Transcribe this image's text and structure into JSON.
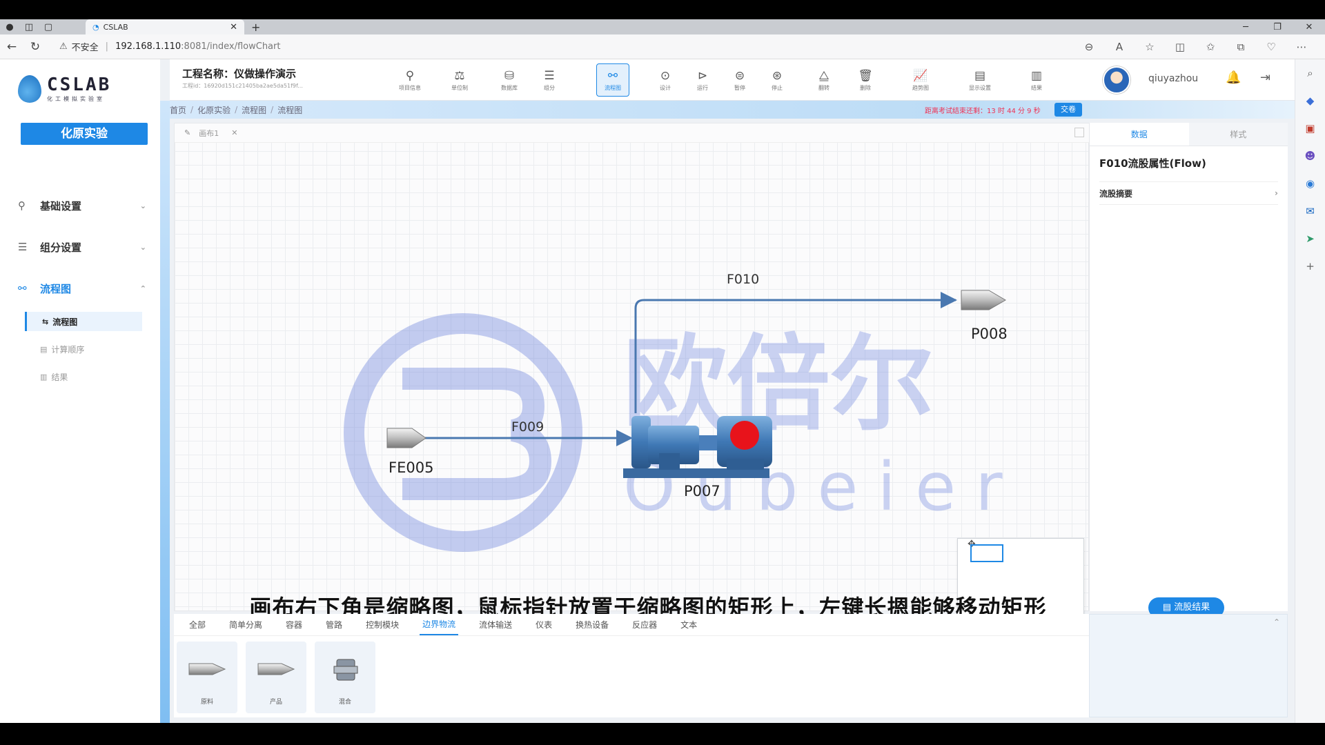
{
  "browser": {
    "tab_title": "CSLAB",
    "security_label": "不安全",
    "url_host": "192.168.1.110",
    "url_path": ":8081/index/flowChart"
  },
  "sidebar": {
    "brand": "CSLAB",
    "brand_sub": "化工模拟实验室",
    "primary_button": "化原实验",
    "groups": [
      {
        "label": "基础设置",
        "icon": "user-tree-icon"
      },
      {
        "label": "组分设置",
        "icon": "components-icon"
      },
      {
        "label": "流程图",
        "icon": "flowchart-icon"
      }
    ],
    "subitems": [
      {
        "label": "流程图",
        "active": true
      },
      {
        "label": "计算顺序",
        "active": false
      },
      {
        "label": "结果",
        "active": false
      }
    ]
  },
  "header": {
    "project_title": "工程名称：仪做操作演示",
    "project_sub": "工程id：16920d151c21405ba2ae5da51f9f...",
    "tools": [
      "项目信息",
      "单位制",
      "数据库",
      "组分",
      "流程图",
      "设计",
      "运行",
      "暂停",
      "停止",
      "翻转",
      "删除",
      "趋势图",
      "显示设置",
      "结果"
    ],
    "active_tool": "流程图",
    "username": "qiuyazhou"
  },
  "breadcrumb": {
    "items": [
      "首页",
      "化原实验",
      "流程图",
      "流程图"
    ],
    "countdown": "距离考试结束还剩：13 时 44 分 9 秒",
    "submit": "交卷"
  },
  "canvas": {
    "tab_name": "画布1",
    "streams": {
      "f010": "F010",
      "f009": "F009"
    },
    "nodes": {
      "fe005": "FE005",
      "p007": "P007",
      "p008": "P008"
    },
    "watermark_cn": "欧倍尔",
    "watermark_en": "Oubeier"
  },
  "caption": "画布右下角是缩略图，鼠标指针放置于缩略图的矩形上，左键长摁能够移动矩形",
  "palette": {
    "tabs": [
      "全部",
      "简单分离",
      "容器",
      "管路",
      "控制模块",
      "边界物流",
      "流体输送",
      "仪表",
      "换热设备",
      "反应器",
      "文本"
    ],
    "active_tab": "边界物流",
    "items": [
      "原料",
      "产品",
      "混合"
    ]
  },
  "properties": {
    "tabs": [
      "数据",
      "样式"
    ],
    "title": "F010流股属性(Flow)",
    "row": "流股摘要",
    "result_button": "流股结果"
  },
  "colors": {
    "accent": "#1e88e5",
    "stream": "#4a78b0",
    "pump_indicator": "#e8131b"
  }
}
